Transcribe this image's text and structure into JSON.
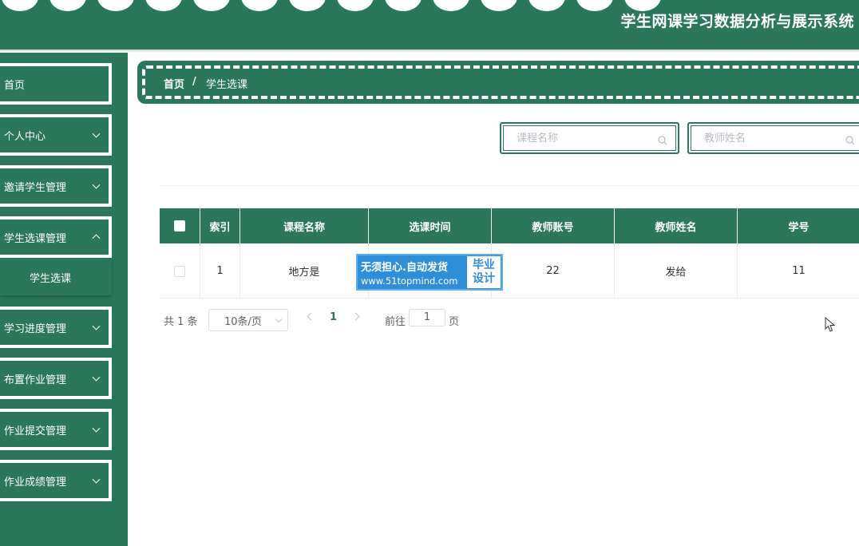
{
  "app": {
    "title": "学生网课学习数据分析与展示系统",
    "theme_color": "#2a775b"
  },
  "sidebar": {
    "items": [
      {
        "label": "首页",
        "expandable": false
      },
      {
        "label": "个人中心",
        "expandable": true
      },
      {
        "label": "邀请学生管理",
        "expandable": true
      },
      {
        "label": "学生选课管理",
        "expandable": true,
        "open": true
      },
      {
        "label": "学习进度管理",
        "expandable": true
      },
      {
        "label": "布置作业管理",
        "expandable": true
      },
      {
        "label": "作业提交管理",
        "expandable": true
      },
      {
        "label": "作业成绩管理",
        "expandable": true
      }
    ],
    "submenu": {
      "label": "学生选课"
    }
  },
  "breadcrumb": {
    "home": "首页",
    "separator": "/",
    "current": "学生选课"
  },
  "search": {
    "course_placeholder": "课程名称",
    "teacher_placeholder": "教师姓名",
    "icon": "search-icon"
  },
  "table": {
    "columns": [
      "索引",
      "课程名称",
      "选课时间",
      "教师账号",
      "教师姓名",
      "学号"
    ],
    "rows": [
      {
        "index": "1",
        "course_name": "地方是",
        "select_time": "",
        "teacher_account": "22",
        "teacher_name": "发给",
        "student_no": "11"
      }
    ]
  },
  "watermark": {
    "line1": "无须担心.自动发货",
    "line2": "www.51topmind.com",
    "right_top": "毕业",
    "right_bottom": "设计",
    "color": "#2f8ed8"
  },
  "pagination": {
    "total_text": "共 1 条",
    "page_size": "10条/页",
    "current_page": "1",
    "goto_label": "前往",
    "goto_value": "1",
    "page_suffix": "页"
  }
}
